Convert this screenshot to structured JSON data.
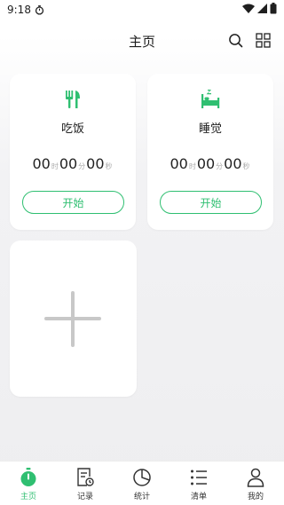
{
  "status_bar": {
    "time": "9:18"
  },
  "header": {
    "title": "主页"
  },
  "tasks": [
    {
      "name": "吃饭",
      "icon": "utensils-icon",
      "hours": "00",
      "minutes": "00",
      "seconds": "00",
      "unit_h": "时",
      "unit_m": "分",
      "unit_s": "秒",
      "start_label": "开始"
    },
    {
      "name": "睡觉",
      "icon": "bed-icon",
      "hours": "00",
      "minutes": "00",
      "seconds": "00",
      "unit_h": "时",
      "unit_m": "分",
      "unit_s": "秒",
      "start_label": "开始"
    }
  ],
  "tabbar": {
    "items": [
      {
        "label": "主页",
        "icon": "timer-icon",
        "active": true
      },
      {
        "label": "记录",
        "icon": "record-icon",
        "active": false
      },
      {
        "label": "统计",
        "icon": "pie-chart-icon",
        "active": false
      },
      {
        "label": "清单",
        "icon": "list-icon",
        "active": false
      },
      {
        "label": "我的",
        "icon": "profile-icon",
        "active": false
      }
    ]
  },
  "colors": {
    "accent": "#2fbf71",
    "background": "#f0f0f2",
    "card": "#ffffff"
  }
}
